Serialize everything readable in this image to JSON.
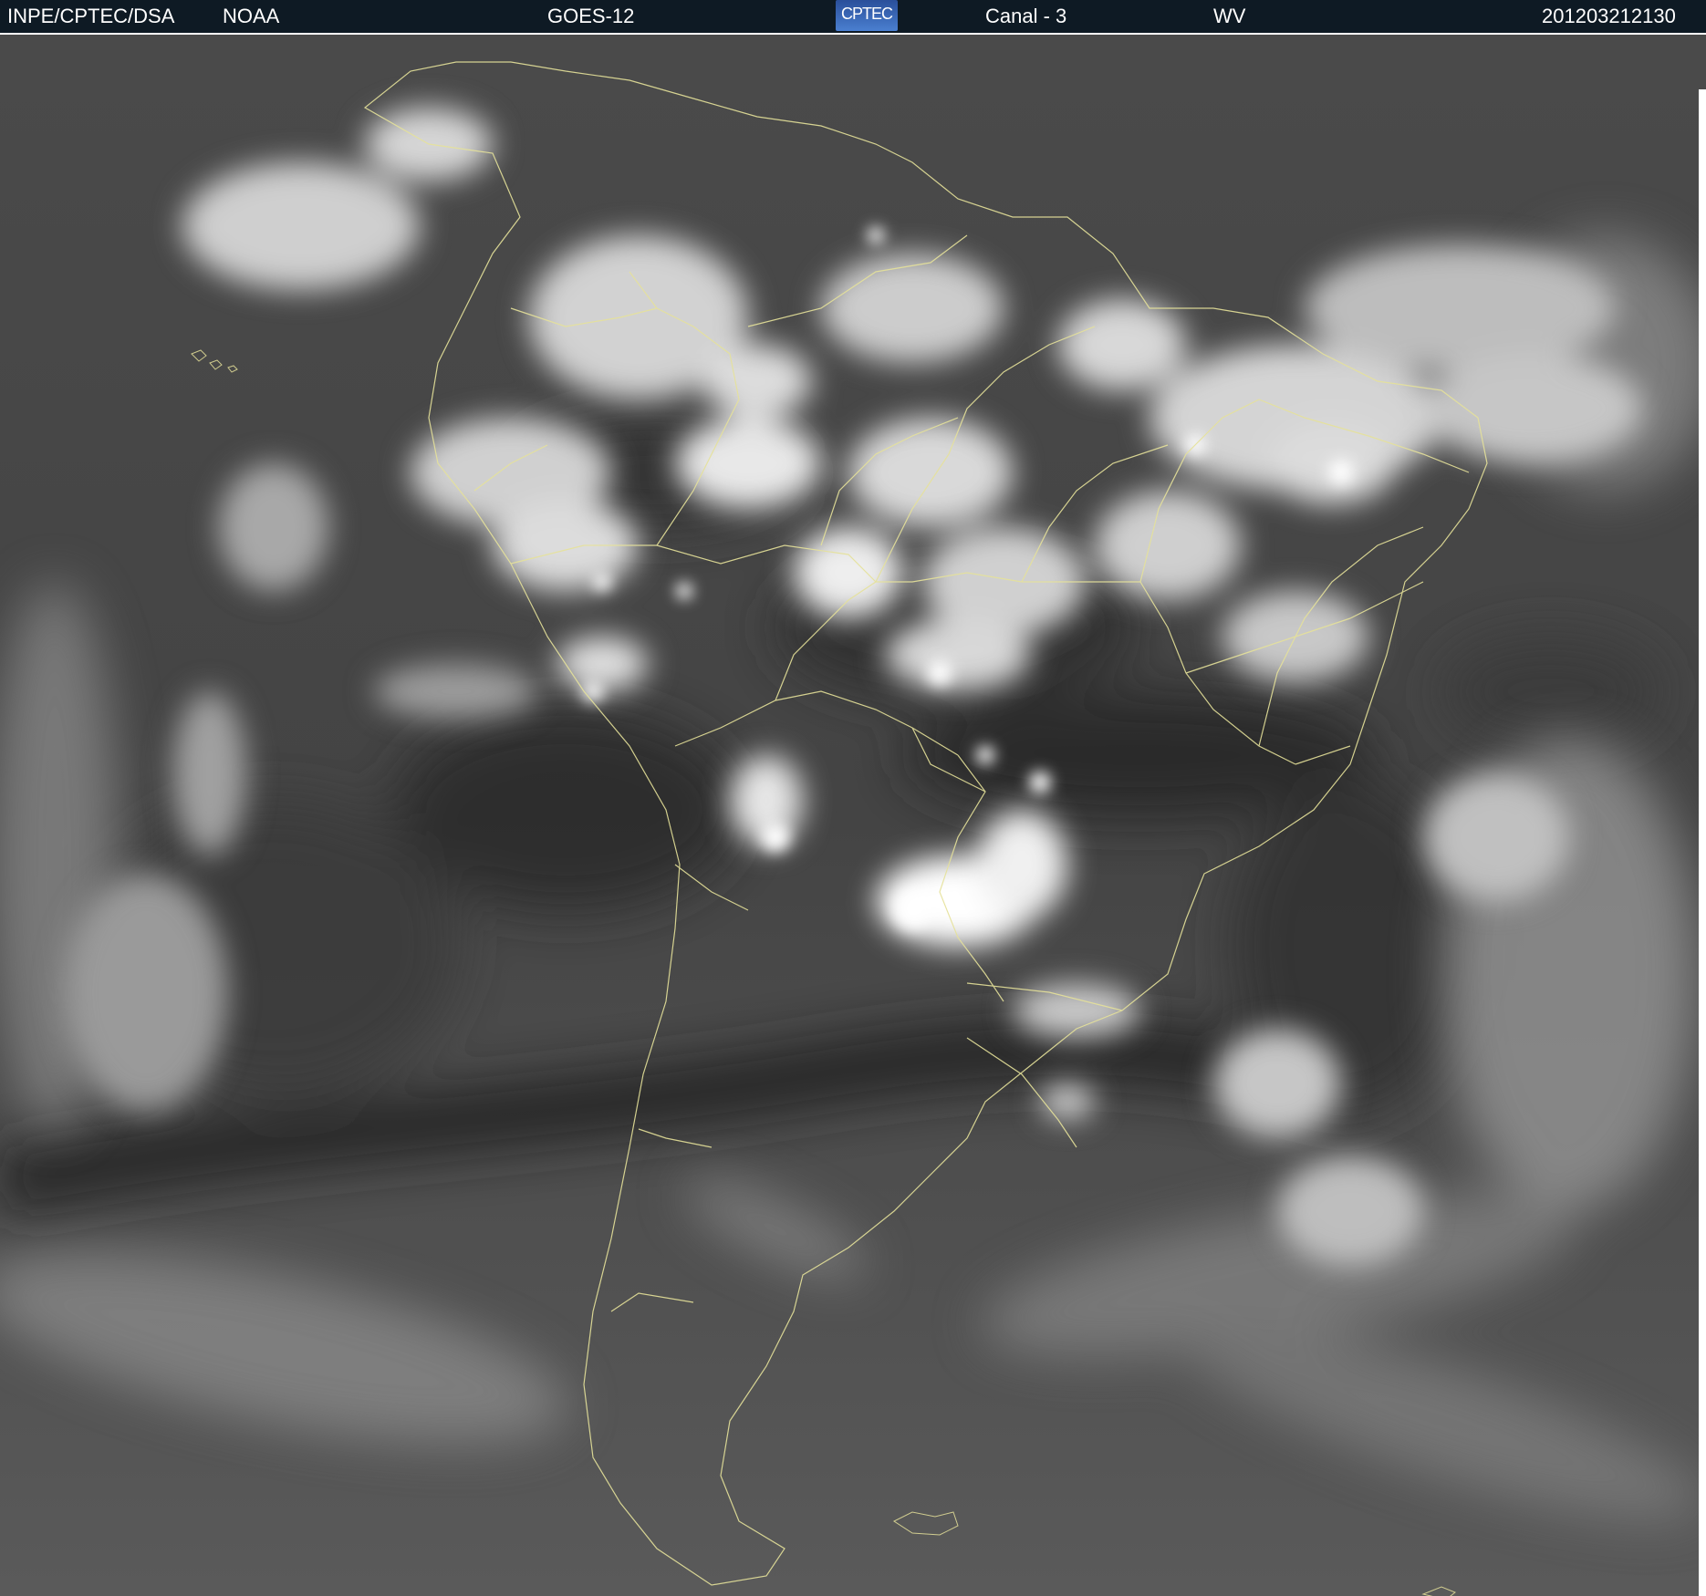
{
  "header": {
    "source": "INPE/CPTEC/DSA",
    "agency": "NOAA",
    "satellite": "GOES-12",
    "logo_text": "CPTEC",
    "channel": "Canal - 3",
    "band": "WV",
    "timestamp": "201203212130"
  },
  "colors": {
    "header_bg": "#0e1a24",
    "header_text": "#ffffff",
    "border_lines": "#e6e29a",
    "sky_dark": "#3a3a3a",
    "sky_mid": "#5a5a5a",
    "cloud": "#f2f2f2"
  },
  "image": {
    "kind": "satellite water-vapor image of South America",
    "logo_icon": "cptec-logo-icon"
  }
}
